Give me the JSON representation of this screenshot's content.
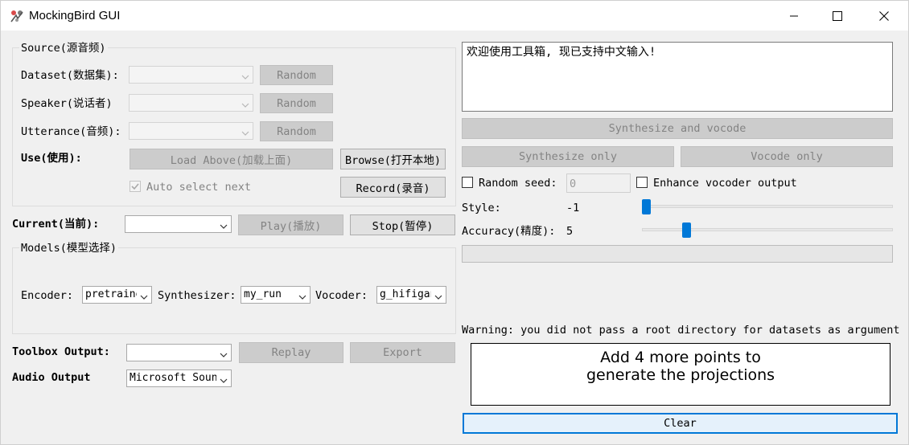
{
  "window": {
    "title": "MockingBird GUI",
    "icon": "mockingbird-logo-icon",
    "controls": [
      "minimize-icon",
      "maximize-icon",
      "close-icon"
    ]
  },
  "source": {
    "group_title": "Source(源音频)",
    "dataset_label": "Dataset(数据集):",
    "speaker_label": "Speaker(说话者)",
    "utterance_label": "Utterance(音频):",
    "random_label": "Random",
    "use_label": "Use(使用):",
    "load_above_label": "Load Above(加载上面)",
    "browse_label": "Browse(打开本地)",
    "record_label": "Record(录音)",
    "auto_select_label": "Auto select next",
    "auto_select_checked": true
  },
  "current": {
    "label": "Current(当前):",
    "play_label": "Play(播放)",
    "stop_label": "Stop(暂停)"
  },
  "models": {
    "group_title": "Models(模型选择)",
    "encoder_label": "Encoder:",
    "encoder_value": "pretrained",
    "synthesizer_label": "Synthesizer:",
    "synthesizer_value": "my_run",
    "vocoder_label": "Vocoder:",
    "vocoder_value": "g_hifigan"
  },
  "toolbox_output": {
    "label": "Toolbox Output:",
    "replay_label": "Replay",
    "export_label": "Export"
  },
  "audio_output": {
    "label": "Audio Output",
    "device_value": "Microsoft Sound Mapper"
  },
  "text_input": {
    "value": "欢迎使用工具箱, 现已支持中文输入!"
  },
  "actions": {
    "synthesize_vocode_label": "Synthesize and vocode",
    "synthesize_only_label": "Synthesize only",
    "vocode_only_label": "Vocode only"
  },
  "options": {
    "random_seed_label": "Random seed:",
    "random_seed_value": "0",
    "random_seed_checked": false,
    "enhance_label": "Enhance vocoder output",
    "enhance_checked": false,
    "style_label": "Style:",
    "style_value": "-1",
    "accuracy_label": "Accuracy(精度):",
    "accuracy_value": "5"
  },
  "warning": {
    "text": "Warning: you did not pass a root directory for datasets as argument"
  },
  "projections": {
    "message_line1": "Add 4 more points to",
    "message_line2": "generate the projections"
  },
  "clear_label": "Clear",
  "colors": {
    "accent": "#0078d7",
    "disabled_button": "#cccccc",
    "disabled_text": "#838383",
    "window_bg": "#f0f0f0"
  }
}
